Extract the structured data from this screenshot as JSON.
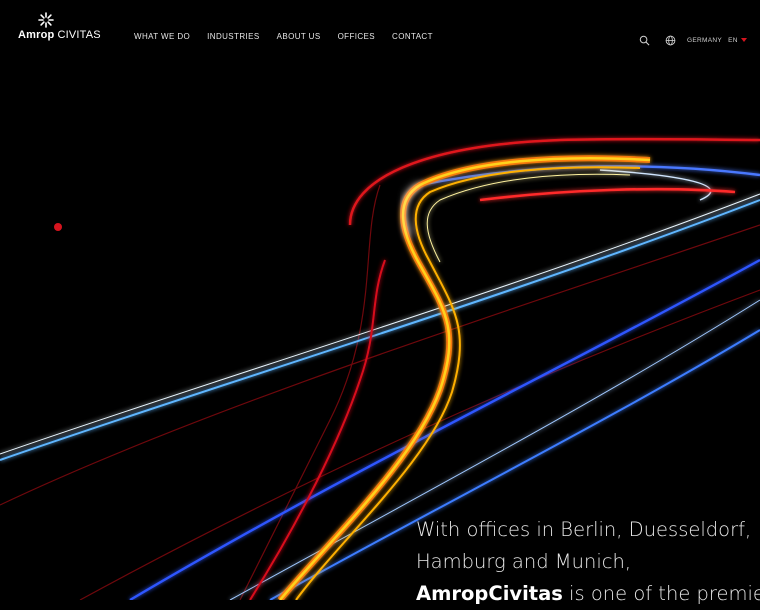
{
  "header": {
    "logo": {
      "bold": "Amrop",
      "light": "CIVITAS"
    },
    "nav": [
      "WHAT WE DO",
      "INDUSTRIES",
      "ABOUT US",
      "OFFICES",
      "CONTACT"
    ],
    "country": "GERMANY",
    "language": "EN"
  },
  "icons": {
    "logo": "sunburst-logo-icon",
    "search": "search-icon",
    "globe": "globe-icon",
    "dropdown": "chevron-down-icon"
  },
  "colors": {
    "background": "#000000",
    "accent": "#d5141e"
  },
  "hero": {
    "line1": "With offices in Berlin, Duesseldorf,",
    "line2": "Hamburg and Munich,",
    "line3_brand": "AmropCivitas",
    "line3_rest": " is one of the premier"
  }
}
